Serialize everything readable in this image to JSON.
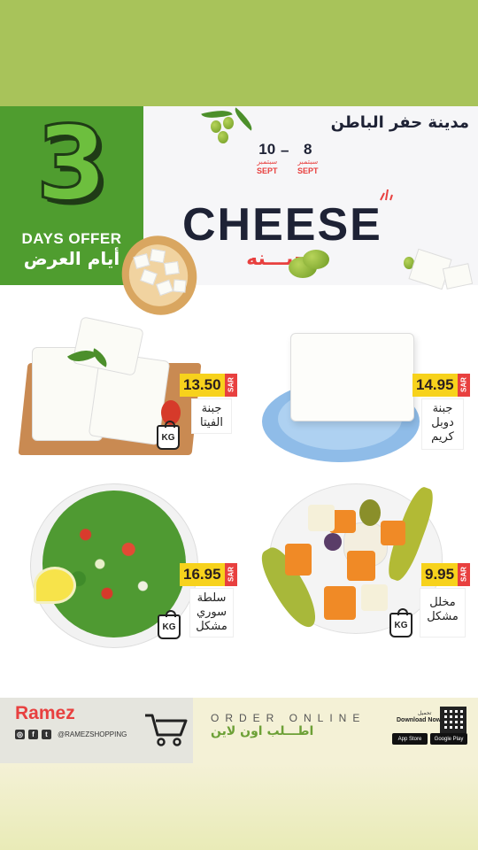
{
  "colors": {
    "top_band": "#a8c35a",
    "green_panel": "#4f9d2f",
    "navy": "#1e2235",
    "accent_red": "#e8403f",
    "price_yellow": "#f7d21c"
  },
  "banner": {
    "big_number": "3",
    "days_offer_en": "DAYS OFFER",
    "days_offer_ar": "أيام العرض",
    "city": "مدينة حفر الباطن",
    "date_from": {
      "day": "8",
      "month_ar": "سبتمبر",
      "month_en": "SEPT"
    },
    "date_dash": "–",
    "date_to": {
      "day": "10",
      "month_ar": "سبتمبر",
      "month_en": "SEPT"
    },
    "title_en": "CHEESE",
    "title_ar": "جبـــنه"
  },
  "products": [
    {
      "name": "جبنة الفيتا",
      "price": "13.50",
      "currency": "SAR",
      "unit_icon": "kg-weight-icon",
      "unit_label": "KG"
    },
    {
      "name": "جبنة دوبل كريم",
      "price": "14.95",
      "currency": "SAR"
    },
    {
      "name": "سلطة سوري مشكل",
      "price": "16.95",
      "currency": "SAR",
      "unit_icon": "kg-weight-icon",
      "unit_label": "KG"
    },
    {
      "name": "مخلل مشكل",
      "price": "9.95",
      "currency": "SAR",
      "unit_icon": "kg-weight-icon",
      "unit_label": "KG"
    }
  ],
  "footer": {
    "brand": "Ramez",
    "social_icons": [
      "instagram-icon",
      "facebook-icon",
      "twitter-icon"
    ],
    "handle": "@RAMEZSHOPPING",
    "cart_icon": "shopping-cart-icon",
    "order_en": "ORDER ONLINE",
    "order_ar": "اطـــلب اون لاين",
    "download_ar": "تحميل",
    "download_en": "Download Now",
    "app_store": "App Store",
    "google_play": "Google Play",
    "qr_icon": "qr-code-icon"
  }
}
